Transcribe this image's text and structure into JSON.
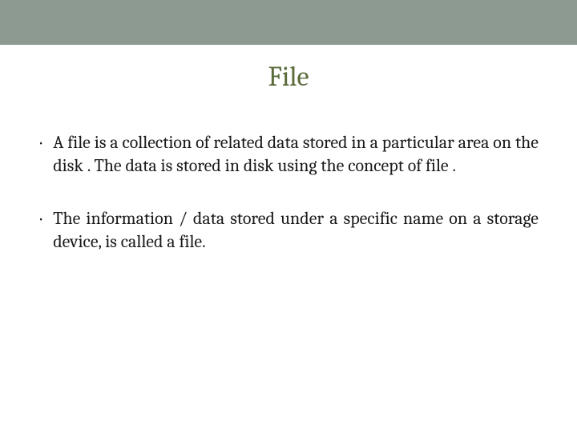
{
  "slide": {
    "title": "File",
    "bullets": [
      "A file is a collection of related data stored in  a particular area on the disk . The data is  stored in disk using the concept of file .",
      "The information / data stored under a specific name on a storage device, is called a file."
    ]
  }
}
